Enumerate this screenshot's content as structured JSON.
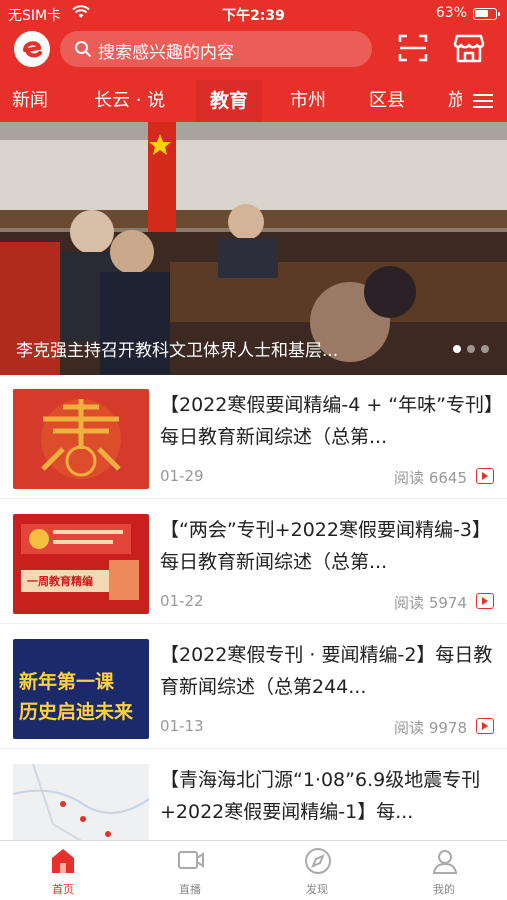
{
  "status": {
    "carrier": "无SIM卡",
    "time": "下午2:39",
    "battery": "63%"
  },
  "search": {
    "placeholder": "搜索感兴趣的内容"
  },
  "tabs": [
    {
      "label": "新闻"
    },
    {
      "label": "长云 · 说"
    },
    {
      "label": "教育",
      "active": true
    },
    {
      "label": "市州"
    },
    {
      "label": "区县"
    },
    {
      "label": "旅"
    }
  ],
  "banner": {
    "caption": "李克强主持召开教科文卫体界人士和基层..."
  },
  "articles": [
    {
      "title": "【2022寒假要闻精编-4 + “年味”专刊】每日教育新闻综述（总第...",
      "date": "01-29",
      "reads": "阅读 6645",
      "thumb_text": ""
    },
    {
      "title": "【“两会”专刊+2022寒假要闻精编-3】每日教育新闻综述（总第...",
      "date": "01-22",
      "reads": "阅读 5974",
      "thumb_text": "一周教育精编"
    },
    {
      "title": "【2022寒假专刊 · 要闻精编-2】每日教育新闻综述（总第244...",
      "date": "01-13",
      "reads": "阅读 9978",
      "thumb_line1": "新年第一课",
      "thumb_line2": "历史启迪未来"
    },
    {
      "title": "【青海海北门源“1·08”6.9级地震专刊+2022寒假要闻精编-1】每...",
      "date": "",
      "reads": ""
    }
  ],
  "nav": [
    {
      "label": "首页",
      "icon": "home-icon",
      "active": true
    },
    {
      "label": "直播",
      "icon": "live-icon"
    },
    {
      "label": "发现",
      "icon": "compass-icon"
    },
    {
      "label": "我的",
      "icon": "user-icon"
    }
  ],
  "colors": {
    "brand": "#e8302a"
  }
}
